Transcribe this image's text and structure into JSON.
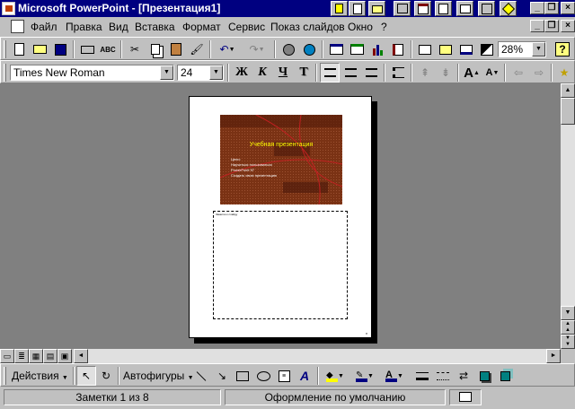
{
  "title_bar": {
    "title": "Microsoft PowerPoint - [Презентация1]"
  },
  "menu": {
    "items": [
      "Файл",
      "Правка",
      "Вид",
      "Вставка",
      "Формат",
      "Сервис",
      "Показ слайдов",
      "Окно",
      "?"
    ]
  },
  "standard_toolbar": {
    "zoom": "28%"
  },
  "formatting_toolbar": {
    "font_name": "Times New Roman",
    "font_size": "24",
    "bold_label": "Ж",
    "italic_label": "К",
    "underline_label": "Ч",
    "shadow_label": "Т"
  },
  "slide": {
    "title": "Учебная презентация",
    "bullets": [
      "Цели:",
      "Научиться пользоваться",
      "PowerPoint 97",
      "Создать свою презентацию"
    ]
  },
  "notes": {
    "text": "Заметки к слайду"
  },
  "drawing_toolbar": {
    "actions_label": "Действия",
    "autoshapes_label": "Автофигуры"
  },
  "status_bar": {
    "page_info": "Заметки 1 из 8",
    "design": "Оформление по умолчанию"
  },
  "colors": {
    "title_bar": "#000080",
    "slide_background": "#6b2a12",
    "slide_title": "#ffff00"
  }
}
